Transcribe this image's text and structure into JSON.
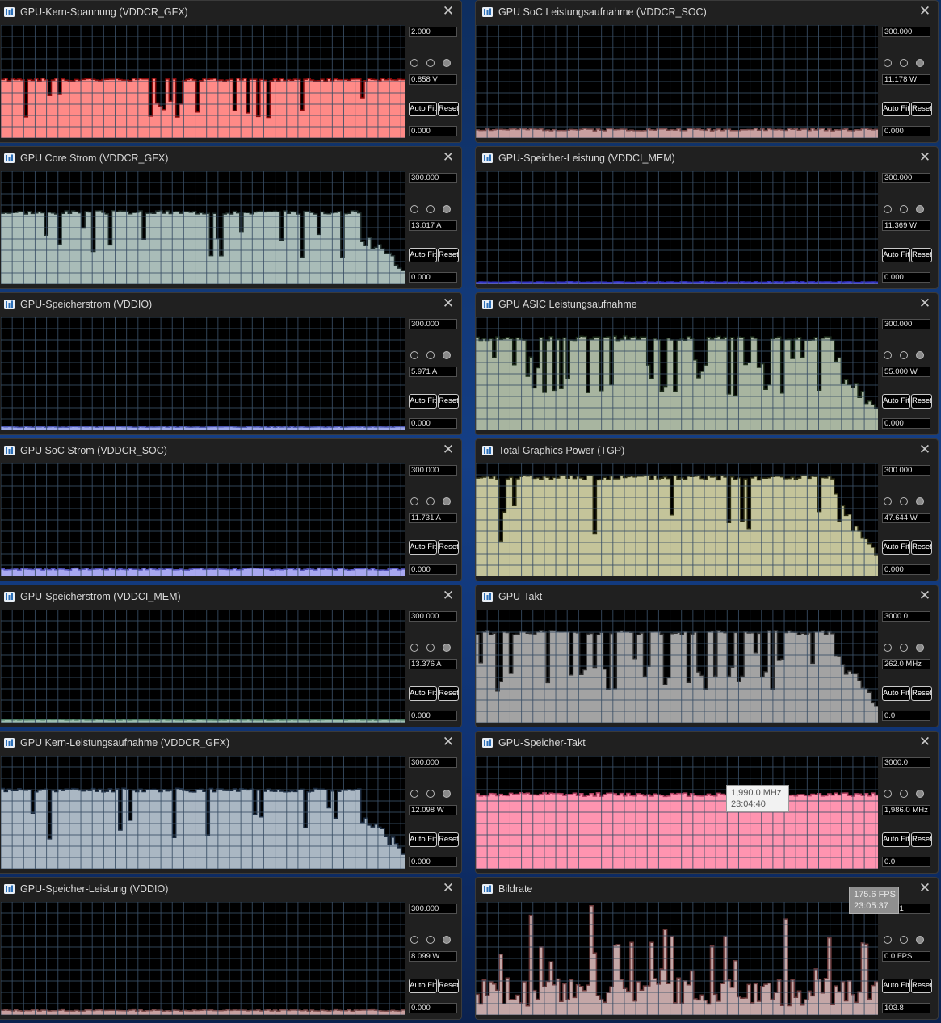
{
  "panels": [
    {
      "title": "GPU-Kern-Spannung (VDDCR_GFX)",
      "max": "2.000",
      "current": "0.858 V",
      "min": "0.000",
      "fill": "#ff8a87",
      "line": "#8a0a0a",
      "level": 0.52,
      "dips": 0.55,
      "drop": 0.0,
      "kind": "flat",
      "seed": 1
    },
    {
      "title": "GPU SoC Leistungsaufnahme (VDDCR_SOC)",
      "max": "300.000",
      "current": "11.178 W",
      "min": "0.000",
      "fill": "#c9a0a0",
      "line": "#7a4a4a",
      "level": 0.075,
      "dips": 0.02,
      "drop": 0.0,
      "kind": "low",
      "seed": 2
    },
    {
      "title": "GPU Core Strom (VDDCR_GFX)",
      "max": "300.000",
      "current": "13.017 A",
      "min": "0.000",
      "fill": "#a9bcb8",
      "line": "#1f2c2a",
      "level": 0.64,
      "dips": 0.4,
      "drop": 0.12,
      "kind": "load",
      "seed": 3
    },
    {
      "title": "GPU-Speicher-Leistung (VDDCI_MEM)",
      "max": "300.000",
      "current": "11.369 W",
      "min": "0.000",
      "fill": "#6a6af0",
      "line": "#3030c0",
      "level": 0.02,
      "dips": 0.0,
      "drop": 0.0,
      "kind": "low",
      "seed": 4
    },
    {
      "title": "GPU-Speicherstrom (VDDIO)",
      "max": "300.000",
      "current": "5.971 A",
      "min": "0.000",
      "fill": "#9da7e8",
      "line": "#4a55b0",
      "level": 0.03,
      "dips": 0.0,
      "drop": 0.0,
      "kind": "low",
      "seed": 5
    },
    {
      "title": "GPU ASIC Leistungsaufnahme",
      "max": "300.000",
      "current": "55.000 W",
      "min": "0.000",
      "fill": "#a8b5a0",
      "line": "#1b2a18",
      "level": 0.82,
      "dips": 0.9,
      "drop": 0.14,
      "kind": "load",
      "seed": 6
    },
    {
      "title": "GPU SoC Strom (VDDCR_SOC)",
      "max": "300.000",
      "current": "11.731 A",
      "min": "0.000",
      "fill": "#a8a8f0",
      "line": "#5050b8",
      "level": 0.065,
      "dips": 0.0,
      "drop": 0.0,
      "kind": "low",
      "seed": 7
    },
    {
      "title": "Total Graphics Power (TGP)",
      "max": "300.000",
      "current": "47.644 W",
      "min": "0.000",
      "fill": "#c4c49a",
      "line": "#2a2a10",
      "level": 0.88,
      "dips": 0.4,
      "drop": 0.14,
      "kind": "load",
      "seed": 8
    },
    {
      "title": "GPU-Speicherstrom (VDDCI_MEM)",
      "max": "300.000",
      "current": "13.376 A",
      "min": "0.000",
      "fill": "#9fbfb0",
      "line": "#4a7a62",
      "level": 0.025,
      "dips": 0.0,
      "drop": 0.0,
      "kind": "low",
      "seed": 9
    },
    {
      "title": "GPU-Takt",
      "max": "3000.0",
      "current": "262.0 MHz",
      "min": "0.0",
      "fill": "#a3a3a3",
      "line": "#2a2a2a",
      "level": 0.8,
      "dips": 0.95,
      "drop": 0.14,
      "kind": "load",
      "seed": 10
    },
    {
      "title": "GPU Kern-Leistungsaufnahme (VDDCR_GFX)",
      "max": "300.000",
      "current": "12.098 W",
      "min": "0.000",
      "fill": "#aab7c3",
      "line": "#1b2a3e",
      "level": 0.7,
      "dips": 0.4,
      "drop": 0.12,
      "kind": "load",
      "seed": 11
    },
    {
      "title": "GPU-Speicher-Takt",
      "max": "3000.0",
      "current": "1,986.0 MHz",
      "min": "0.0",
      "fill": "#ff94b0",
      "line": "#b04060",
      "level": 0.66,
      "dips": 0.0,
      "drop": 0.0,
      "kind": "flat",
      "seed": 12
    },
    {
      "title": "GPU-Speicher-Leistung (VDDIO)",
      "max": "300.000",
      "current": "8.099 W",
      "min": "0.000",
      "fill": "#c8a0a0",
      "line": "#7a4a4a",
      "level": 0.04,
      "dips": 0.0,
      "drop": 0.0,
      "kind": "low",
      "seed": 13
    },
    {
      "title": "Bildrate",
      "max": "415.1",
      "current": "0.0 FPS",
      "min": "103.8",
      "fill": "#c4a7a7",
      "line": "#6a3838",
      "level": 0.3,
      "dips": 0.0,
      "drop": 0.0,
      "kind": "spiky",
      "seed": 14
    }
  ],
  "buttons": {
    "auto_fit": "Auto Fit",
    "reset": "Reset"
  },
  "tooltips": {
    "mem_clock": {
      "value": "1,990.0 MHz",
      "time": "23:04:40"
    },
    "fps": {
      "value": "175.6 FPS",
      "time": "23:05:37"
    }
  },
  "colors": {
    "graph_bg": "#000000",
    "grid": "#3a4f66",
    "window_bg": "#202020",
    "title_text": "#d8d8d8"
  },
  "icons": {
    "app": "hwinfo-sensor-icon",
    "close": "close-icon"
  }
}
